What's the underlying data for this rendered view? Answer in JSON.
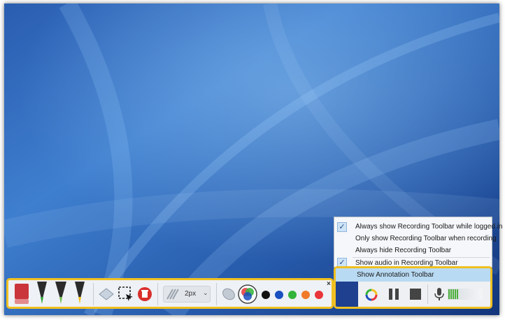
{
  "annotation_toolbar": {
    "tools": [
      {
        "name": "eraser-icon",
        "color": "#c9353a"
      },
      {
        "name": "pen-green-icon",
        "color": "#2fa43a"
      },
      {
        "name": "pen-dark-icon",
        "color": "#333333"
      },
      {
        "name": "highlighter-yellow-icon",
        "color": "#f0c020"
      },
      {
        "name": "select-eraser-icon"
      },
      {
        "name": "selection-cursor-icon"
      },
      {
        "name": "delete-icon",
        "color": "#d9302b"
      },
      {
        "name": "brush-texture-icon"
      }
    ],
    "size_value": "2px",
    "size_chevron": "⌄",
    "close_glyph": "×",
    "colors": [
      "#111111",
      "#1a4fc0",
      "#33b33a",
      "#f07a2a",
      "#e8343a"
    ]
  },
  "menu": {
    "items": [
      {
        "label": "Always show Recording Toolbar while logged in",
        "checked": true
      },
      {
        "label": "Only show Recording Toolbar when recording",
        "checked": false
      },
      {
        "label": "Always hide Recording Toolbar",
        "checked": false
      },
      {
        "label": "Show audio in Recording Toolbar",
        "checked": true
      }
    ],
    "check_glyph": "✓"
  },
  "recording_toolbar": {
    "highlight_label": "Show Annotation Toolbar",
    "controls": [
      "annotation-toggle-icon",
      "pause-icon",
      "stop-icon",
      "microphone-icon",
      "audio-level-meter"
    ]
  }
}
